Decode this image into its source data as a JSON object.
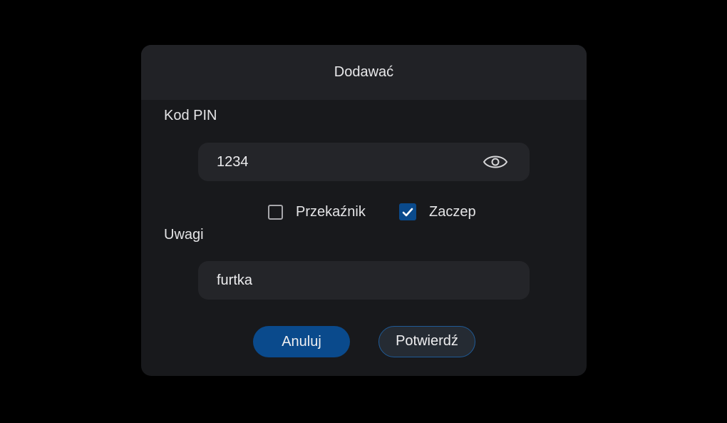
{
  "dialog": {
    "title": "Dodawać",
    "pin": {
      "label": "Kod PIN",
      "value": "1234",
      "visibility_icon": "eye-icon"
    },
    "options": [
      {
        "label": "Przekaźnik",
        "checked": false
      },
      {
        "label": "Zaczep",
        "checked": true
      }
    ],
    "notes": {
      "label": "Uwagi",
      "value": "furtka"
    },
    "buttons": {
      "cancel": "Anuluj",
      "confirm": "Potwierdź"
    }
  },
  "colors": {
    "background": "#000000",
    "dialog": "#18191c",
    "header": "#212226",
    "field": "#242529",
    "accent": "#0a4a8c"
  }
}
